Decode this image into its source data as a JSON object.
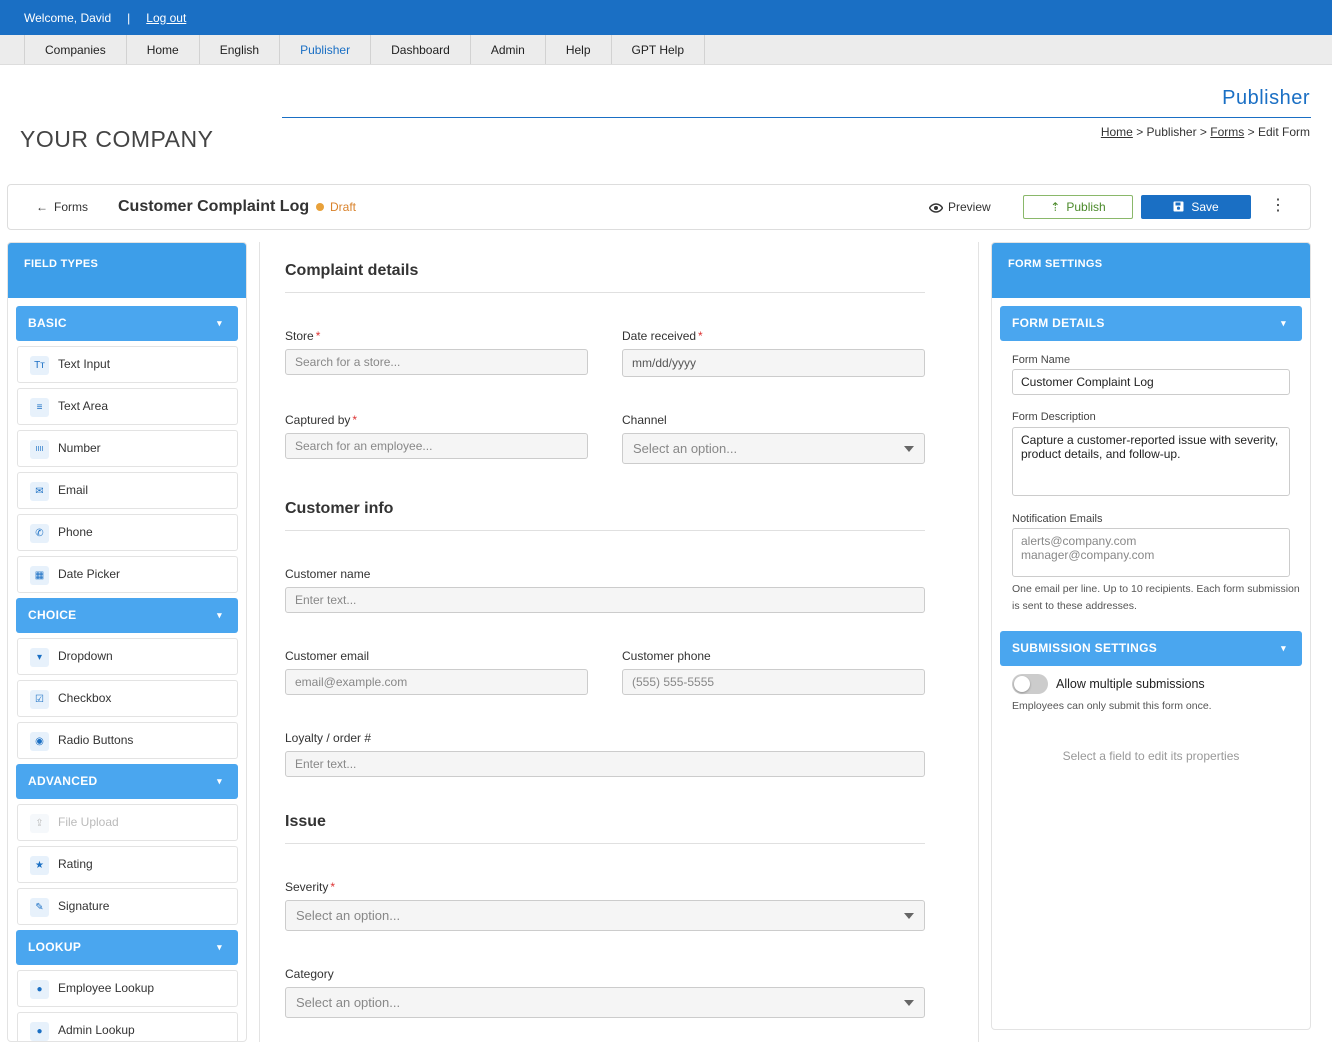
{
  "topbar": {
    "welcome": "Welcome, David",
    "separator": "|",
    "logout": "Log out"
  },
  "nav": {
    "items": [
      "Companies",
      "Home",
      "English",
      "Publisher",
      "Dashboard",
      "Admin",
      "Help",
      "GPT Help"
    ],
    "active": "Publisher"
  },
  "header": {
    "section_title": "Publisher",
    "company": "YOUR COMPANY",
    "breadcrumb": {
      "home": "Home",
      "sep1": ">",
      "publisher": "Publisher",
      "sep2": ">",
      "forms": "Forms",
      "sep3": ">",
      "current": "Edit Form"
    }
  },
  "toolbar": {
    "back_label": "Forms",
    "form_title": "Customer Complaint Log",
    "status": "Draft",
    "preview_label": "Preview",
    "publish_label": "Publish",
    "save_label": "Save",
    "more_icon": "⋮"
  },
  "field_types": {
    "title": "FIELD TYPES",
    "categories": [
      {
        "label": "BASIC",
        "items": [
          {
            "label": "Text Input",
            "icon": "text-icon",
            "glyph": "Tт"
          },
          {
            "label": "Text Area",
            "icon": "lines-icon",
            "glyph": "≡"
          },
          {
            "label": "Number",
            "icon": "number-icon",
            "glyph": "IIII"
          },
          {
            "label": "Email",
            "icon": "email-icon",
            "glyph": "✉"
          },
          {
            "label": "Phone",
            "icon": "phone-icon",
            "glyph": "✆"
          },
          {
            "label": "Date Picker",
            "icon": "calendar-icon",
            "glyph": "▦"
          }
        ]
      },
      {
        "label": "CHOICE",
        "items": [
          {
            "label": "Dropdown",
            "icon": "dropdown-icon",
            "glyph": "▾"
          },
          {
            "label": "Checkbox",
            "icon": "checkbox-icon",
            "glyph": "☑"
          },
          {
            "label": "Radio Buttons",
            "icon": "radio-icon",
            "glyph": "◉"
          }
        ]
      },
      {
        "label": "ADVANCED",
        "items": [
          {
            "label": "File Upload",
            "icon": "upload-icon",
            "glyph": "⇪",
            "disabled": true
          },
          {
            "label": "Rating",
            "icon": "star-icon",
            "glyph": "★"
          },
          {
            "label": "Signature",
            "icon": "pen-icon",
            "glyph": "✎"
          }
        ]
      },
      {
        "label": "LOOKUP",
        "items": [
          {
            "label": "Employee Lookup",
            "icon": "person-icon",
            "glyph": "👤"
          },
          {
            "label": "Admin Lookup",
            "icon": "admin-icon",
            "glyph": "👤"
          }
        ]
      }
    ]
  },
  "form": {
    "sections": [
      {
        "title": "Complaint details"
      },
      {
        "title": "Customer info"
      },
      {
        "title": "Issue"
      }
    ],
    "fields": {
      "store": {
        "label": "Store",
        "required": "*",
        "placeholder": "Search for a store..."
      },
      "date_received": {
        "label": "Date received",
        "required": "*",
        "placeholder": "mm/dd/yyyy"
      },
      "captured_by": {
        "label": "Captured by",
        "required": "*",
        "placeholder": "Search for an employee..."
      },
      "channel": {
        "label": "Channel",
        "placeholder": "Select an option..."
      },
      "customer_name": {
        "label": "Customer name",
        "placeholder": "Enter text..."
      },
      "customer_email": {
        "label": "Customer email",
        "placeholder": "email@example.com"
      },
      "customer_phone": {
        "label": "Customer phone",
        "placeholder": "(555) 555-5555"
      },
      "loyalty": {
        "label": "Loyalty / order #",
        "placeholder": "Enter text..."
      },
      "severity": {
        "label": "Severity",
        "required": "*",
        "placeholder": "Select an option..."
      },
      "category": {
        "label": "Category",
        "placeholder": "Select an option..."
      }
    }
  },
  "settings": {
    "title": "FORM SETTINGS",
    "form_details": {
      "label": "FORM DETAILS",
      "name_label": "Form Name",
      "name_value": "Customer Complaint Log",
      "desc_label": "Form Description",
      "desc_value": "Capture a customer-reported issue with severity, product details, and follow-up.",
      "emails_label": "Notification Emails",
      "emails_placeholder_1": "alerts@company.com",
      "emails_placeholder_2": "manager@company.com",
      "emails_help": "One email per line. Up to 10 recipients. Each form submission is sent to these addresses."
    },
    "submission": {
      "label": "SUBMISSION SETTINGS",
      "toggle_label": "Allow multiple submissions",
      "toggle_on": false,
      "help": "Employees can only submit this form once."
    },
    "empty_hint": "Select a field to edit its properties"
  },
  "colors": {
    "brand": "#1a6fc4",
    "accent": "#4aa6ef",
    "draft": "#e8a13a",
    "publish": "#4b8a2a"
  }
}
